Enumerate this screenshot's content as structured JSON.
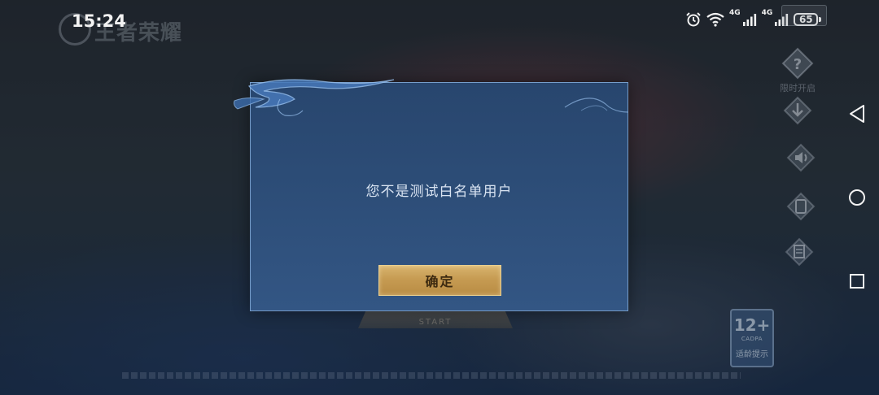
{
  "status_bar": {
    "time": "15:24",
    "network_1": "4G",
    "network_2": "4G",
    "battery_level": "65"
  },
  "game": {
    "title": "王者荣耀"
  },
  "side_menu": {
    "item_1_label": "限时开启",
    "item_2_label": "",
    "item_3_label": "",
    "item_4_label": "",
    "item_5_label": "适龄提示"
  },
  "background": {
    "start_sub": "START"
  },
  "age_rating": {
    "number": "12+",
    "org": "CADPA",
    "note": "适龄提示"
  },
  "dialog": {
    "message": "您不是测试白名单用户",
    "confirm_label": "确定",
    "accent_color": "#c69b52",
    "panel_color": "#2c4c76"
  },
  "nav": {
    "back_icon": "triangle-back-icon",
    "home_icon": "circle-home-icon",
    "recents_icon": "square-recents-icon"
  }
}
